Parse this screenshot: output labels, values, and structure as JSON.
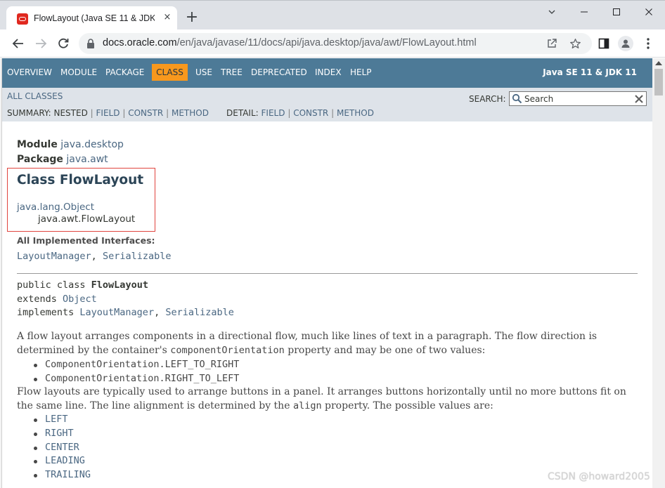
{
  "browser": {
    "tab_title": "FlowLayout (Java SE 11 & JDK",
    "tab_close": "×",
    "new_tab": "+",
    "url_domain": "docs.oracle.com",
    "url_path": "/en/java/javase/11/docs/api/java.desktop/java/awt/FlowLayout.html",
    "icons": [
      "back-icon",
      "forward-icon",
      "reload-icon",
      "lock-icon",
      "share-icon",
      "star-icon",
      "sidebar-icon",
      "profile-icon",
      "menu-icon"
    ]
  },
  "topnav": {
    "items": [
      "OVERVIEW",
      "MODULE",
      "PACKAGE",
      "CLASS",
      "USE",
      "TREE",
      "DEPRECATED",
      "INDEX",
      "HELP"
    ],
    "active": "CLASS",
    "brand": "Java SE 11 & JDK 11"
  },
  "subnav": {
    "all_classes": "ALL CLASSES",
    "search_label": "SEARCH:",
    "search_placeholder": "Search",
    "summary_label": "SUMMARY:",
    "summary_plain": "NESTED",
    "summary_links": [
      "FIELD",
      "CONSTR",
      "METHOD"
    ],
    "detail_label": "DETAIL:",
    "detail_links": [
      "FIELD",
      "CONSTR",
      "METHOD"
    ],
    "separator": "|"
  },
  "header": {
    "module_label": "Module",
    "module_name": "java.desktop",
    "package_label": "Package",
    "package_name": "java.awt",
    "title": "Class FlowLayout",
    "superclass": "java.lang.Object",
    "class_fqn": "java.awt.FlowLayout",
    "impl_label": "All Implemented Interfaces:",
    "interfaces": [
      "LayoutManager",
      "Serializable"
    ],
    "comma": ", "
  },
  "declaration": {
    "line1_prefix": "public class ",
    "class_name": "FlowLayout",
    "line2_prefix": "extends ",
    "extends_name": "Object",
    "line3_prefix": "implements ",
    "interfaces": [
      "LayoutManager",
      "Serializable"
    ],
    "comma": ", "
  },
  "description": {
    "para1_a": "A flow layout arranges components in a directional flow, much like lines of text in a paragraph. The flow direction is determined by the container's ",
    "para1_code": "componentOrientation",
    "para1_b": " property and may be one of two values:",
    "orientations": [
      "ComponentOrientation.LEFT_TO_RIGHT",
      "ComponentOrientation.RIGHT_TO_LEFT"
    ],
    "para2_a": "Flow layouts are typically used to arrange buttons in a panel. It arranges buttons horizontally until no more buttons fit on the same line. The line alignment is determined by the ",
    "para2_code": "align",
    "para2_b": " property. The possible values are:",
    "align_values": [
      "LEFT",
      "RIGHT",
      "CENTER",
      "LEADING",
      "TRAILING"
    ]
  },
  "colors": {
    "nav_bg": "#4d7a97",
    "subnav_bg": "#dee3e9",
    "active_tab": "#f8981d",
    "link": "#4a6782",
    "highlight_border": "#e0443e"
  },
  "watermark": "CSDN @howard2005"
}
